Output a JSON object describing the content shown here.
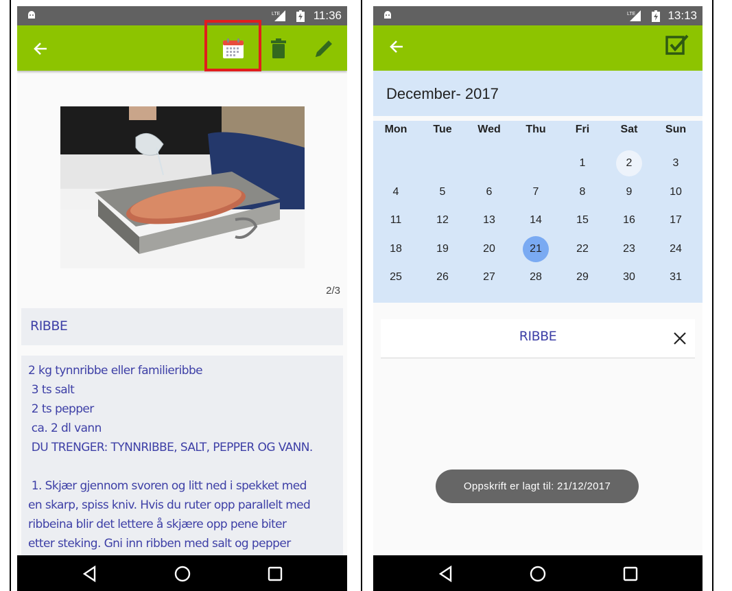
{
  "left": {
    "status": {
      "time": "11:36",
      "network": "LTE"
    },
    "appbar": {
      "back_icon": "arrow-left-icon",
      "calendar_icon": "calendar-icon",
      "delete_icon": "trash-icon",
      "edit_icon": "pencil-icon"
    },
    "image_counter": "2/3",
    "recipe_title": "RIBBE",
    "recipe_lines": [
      "2 kg tynnribbe eller familieribbe",
      " 3 ts salt",
      " 2 ts pepper",
      " ca. 2 dl vann",
      " DU TRENGER: TYNNRIBBE, SALT, PEPPER OG VANN.",
      "",
      " 1. Skjær gjennom svoren og litt ned i spekket med",
      "en skarp, spiss kniv. Hvis du ruter opp parallelt med",
      "ribbeina blir det lettere å skjære opp pene biter",
      "etter steking. Gni inn ribben med salt og pepper"
    ]
  },
  "right": {
    "status": {
      "time": "13:13",
      "network": "LTE"
    },
    "appbar": {
      "back_icon": "arrow-left-icon",
      "confirm_icon": "checkbox-checked-icon"
    },
    "month_label": "December- 2017",
    "weekdays": [
      "Mon",
      "Tue",
      "Wed",
      "Thu",
      "Fri",
      "Sat",
      "Sun"
    ],
    "weeks": [
      [
        "",
        "",
        "",
        "",
        "1",
        "2",
        "3"
      ],
      [
        "4",
        "5",
        "6",
        "7",
        "8",
        "9",
        "10"
      ],
      [
        "11",
        "12",
        "13",
        "14",
        "15",
        "16",
        "17"
      ],
      [
        "18",
        "19",
        "20",
        "21",
        "22",
        "23",
        "24"
      ],
      [
        "25",
        "26",
        "27",
        "28",
        "29",
        "30",
        "31"
      ]
    ],
    "today": "2",
    "selected": "21",
    "recipe_title": "RIBBE",
    "toast": "Oppskrift er lagt til: 21/12/2017"
  },
  "colors": {
    "appbar": "#8dc400",
    "calendar_bg": "#d6e6f8",
    "selected_day": "#7aaaf2",
    "recipe_text": "#3d3fa6",
    "highlight": "#e11d1d"
  }
}
